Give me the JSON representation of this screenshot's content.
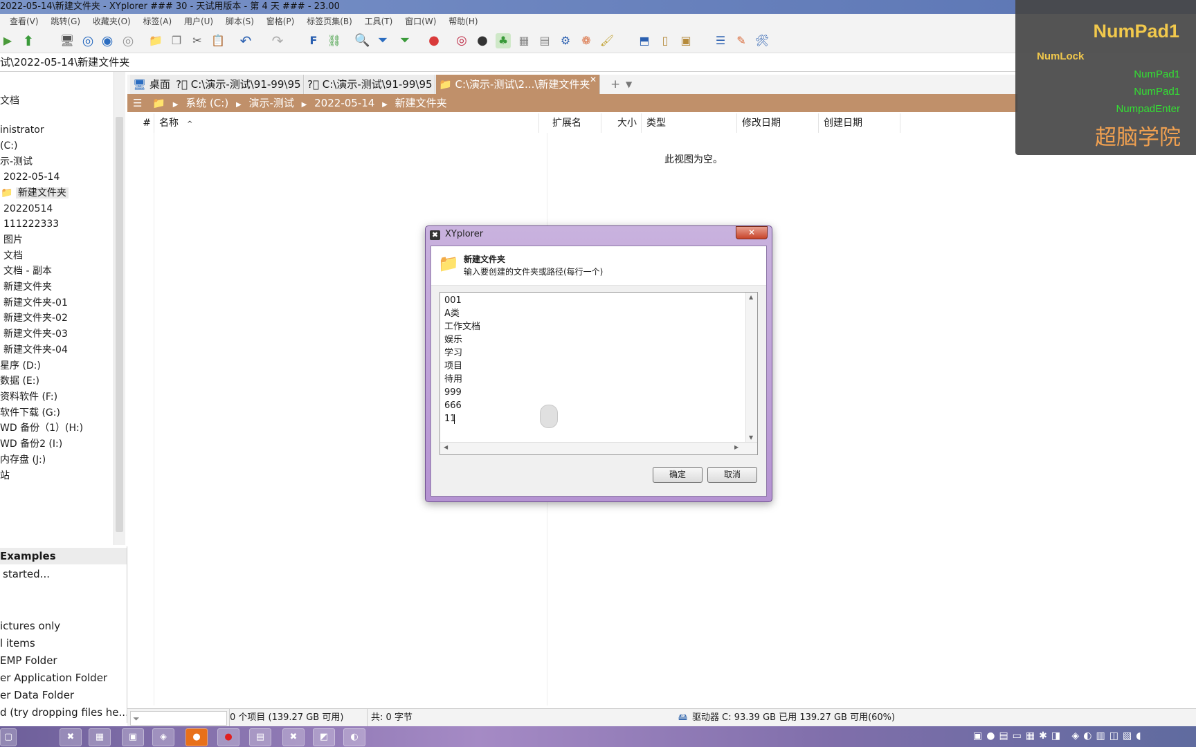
{
  "window": {
    "title": "2022-05-14\\新建文件夹 - XYplorer ### 30 - 天试用版本 - 第 4 天 ### - 23.00"
  },
  "menu": [
    "查看(V)",
    "跳转(G)",
    "收藏夹(O)",
    "标签(A)",
    "用户(U)",
    "脚本(S)",
    "窗格(P)",
    "标签页集(B)",
    "工具(T)",
    "窗口(W)",
    "帮助(H)"
  ],
  "address": "试\\2022-05-14\\新建文件夹",
  "tree": {
    "items": [
      "文档",
      "inistrator",
      "(C:)",
      "示-测试",
      "2022-05-14",
      "新建文件夹",
      "20220514",
      "111222333",
      "图片",
      "文档",
      "文档 - 副本",
      "新建文件夹",
      "新建文件夹-01",
      "新建文件夹-02",
      "新建文件夹-03",
      "新建文件夹-04",
      "星序 (D:)",
      "数据 (E:)",
      "资料软件 (F:)",
      "软件下载 (G:)",
      "WD 备份（1）(H:)",
      "WD 备份2 (I:)",
      "内存盘 (J:)",
      "站"
    ]
  },
  "catalog": {
    "items": [
      "Examples",
      "started...",
      "ictures only",
      "l items",
      "EMP Folder",
      "er Application Folder",
      "er Data Folder",
      "d (try dropping files he..."
    ]
  },
  "tabs": [
    {
      "label": "桌面"
    },
    {
      "label": "C:\\演示-测试\\91-99\\95"
    },
    {
      "label": "C:\\演示-测试\\91-99\\95"
    },
    {
      "label": "C:\\演示-测试\\2...\\新建文件夹",
      "active": true
    }
  ],
  "breadcrumb": [
    "系统 (C:)",
    "演示-测试",
    "2022-05-14",
    "新建文件夹"
  ],
  "columns": [
    "#",
    "名称",
    "扩展名",
    "大小",
    "类型",
    "修改日期",
    "创建日期"
  ],
  "list": {
    "empty_text": "此视图为空。"
  },
  "status": {
    "items": "0 个项目 (139.27 GB 可用)",
    "total": "共: 0 字节",
    "drive": "驱动器 C:  93.39 GB 已用   139.27 GB 可用(60%)"
  },
  "overlay": {
    "big": "NumPad1",
    "numlock": "NumLock",
    "k1": "NumPad1",
    "k2": "NumPad1",
    "k3": "NumpadEnter",
    "brand": "超脑学院"
  },
  "dialog": {
    "title": "XYplorer",
    "close_icon": "close-icon",
    "heading": "新建文件夹",
    "instruction": "输入要创建的文件夹或路径(每行一个)",
    "lines": [
      "001",
      "A类",
      "工作文档",
      "娱乐",
      "学习",
      "项目",
      "待用",
      "999",
      "666",
      "11"
    ],
    "ok": "确定",
    "cancel": "取消"
  },
  "colors": {
    "accent_tab": "#c0906a",
    "overlay_big": "#f2c94c",
    "overlay_green": "#33e033",
    "overlay_brand": "#f0a050"
  }
}
